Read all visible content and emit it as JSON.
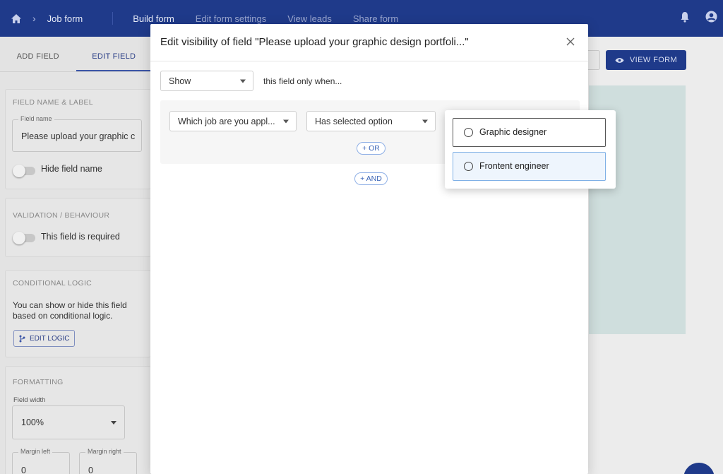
{
  "topbar": {
    "crumb": "Job form",
    "nav": [
      "Build form",
      "Edit form settings",
      "View leads",
      "Share form"
    ],
    "colors": {
      "bg": "#1f3a8a"
    }
  },
  "leftpanel": {
    "tabs": [
      "ADD FIELD",
      "EDIT FIELD"
    ],
    "field_name_section": {
      "heading": "FIELD NAME & LABEL",
      "field_label": "Field name",
      "field_value": "Please upload your graphic c",
      "toggle_label": "Hide field name"
    },
    "validation_section": {
      "heading": "VALIDATION / BEHAVIOUR",
      "toggle_label": "This field is required"
    },
    "conditional_section": {
      "heading": "CONDITIONAL LOGIC",
      "description_line1": "You can show or hide this field",
      "description_line2": "based on conditional logic.",
      "button": "EDIT LOGIC"
    },
    "formatting_section": {
      "heading": "FORMATTING",
      "width_label": "Field width",
      "width_value": "100%",
      "margin_left_label": "Margin left",
      "margin_left_value": "0",
      "margin_right_label": "Margin right",
      "margin_right_value": "0"
    }
  },
  "right": {
    "view_form_button": "VIEW FORM"
  },
  "modal": {
    "title": "Edit visibility of field \"Please upload your graphic design portfoli...\"",
    "visibility_select": "Show",
    "visibility_suffix": "this field only when...",
    "condition": {
      "field_select": "Which job are you appl...",
      "operator_select": "Has selected option"
    },
    "or_button": "+ OR",
    "and_button": "+ AND"
  },
  "dropdown": {
    "options": [
      "Graphic designer",
      "Frontent engineer"
    ]
  }
}
